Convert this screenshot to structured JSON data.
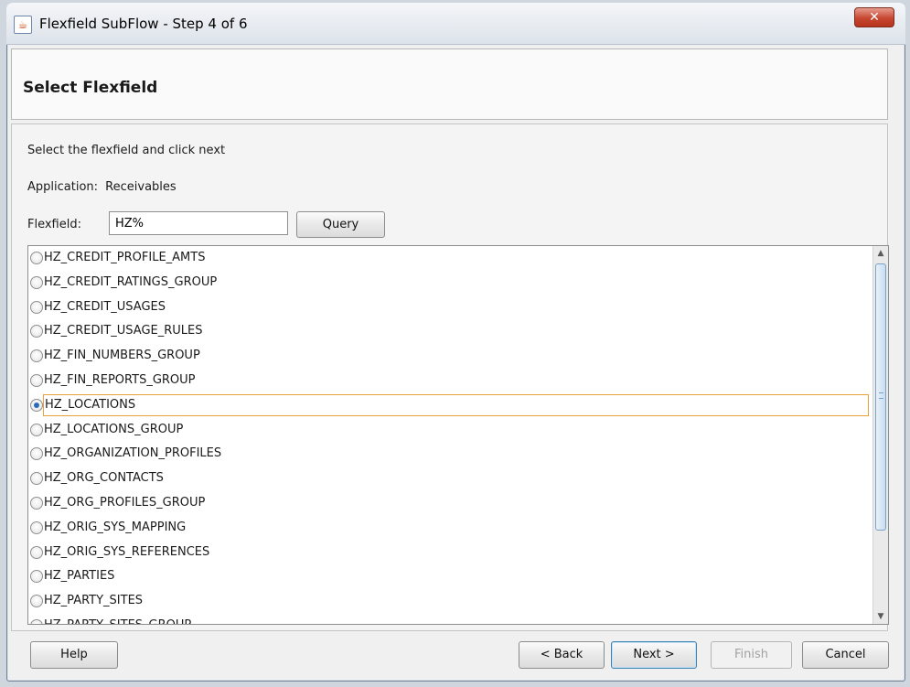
{
  "window": {
    "title": "Flexfield SubFlow - Step 4 of 6"
  },
  "header": {
    "title": "Select Flexfield"
  },
  "content": {
    "instruction": "Select the flexfield and click next",
    "application_label": "Application:",
    "application_value": "Receivables",
    "flexfield_label": "Flexfield:",
    "flexfield_value": "HZ%",
    "query_button": "Query"
  },
  "list": {
    "selected_index": 6,
    "items": [
      "HZ_CREDIT_PROFILE_AMTS",
      "HZ_CREDIT_RATINGS_GROUP",
      "HZ_CREDIT_USAGES",
      "HZ_CREDIT_USAGE_RULES",
      "HZ_FIN_NUMBERS_GROUP",
      "HZ_FIN_REPORTS_GROUP",
      "HZ_LOCATIONS",
      "HZ_LOCATIONS_GROUP",
      "HZ_ORGANIZATION_PROFILES",
      "HZ_ORG_CONTACTS",
      "HZ_ORG_PROFILES_GROUP",
      "HZ_ORIG_SYS_MAPPING",
      "HZ_ORIG_SYS_REFERENCES",
      "HZ_PARTIES",
      "HZ_PARTY_SITES",
      "HZ_PARTY_SITES_GROUP"
    ]
  },
  "buttons": {
    "help": "Help",
    "back": "< Back",
    "next": "Next >",
    "finish": "Finish",
    "cancel": "Cancel"
  },
  "icons": {
    "app": "java-cup-icon",
    "close": "close-icon",
    "scroll_up": "chevron-up-icon",
    "scroll_down": "chevron-down-icon"
  },
  "colors": {
    "close_button": "#c6462f",
    "selection_border": "#e8a23b",
    "radio_checked": "#2c69b7",
    "scroll_thumb": "#c8dcf1"
  }
}
